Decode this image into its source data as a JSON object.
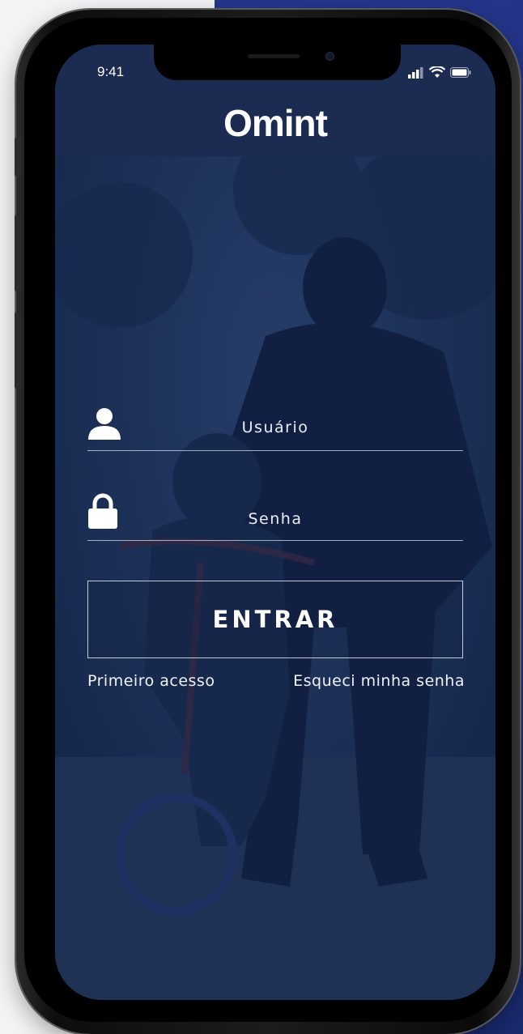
{
  "status_bar": {
    "time": "9:41"
  },
  "header": {
    "logo_text": "Omint"
  },
  "login": {
    "username_label": "Usuário",
    "password_label": "Senha",
    "submit_label": "ENTRAR",
    "first_access_link": "Primeiro acesso",
    "forgot_password_link": "Esqueci minha senha"
  },
  "colors": {
    "header_bg": "#1b2b51",
    "overlay": "#14264e",
    "background_accent": "#1d2f82"
  }
}
